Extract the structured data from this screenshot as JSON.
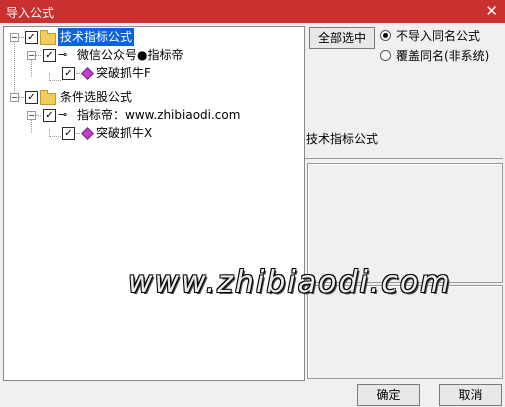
{
  "window": {
    "title": "导入公式",
    "close_glyph": "✕"
  },
  "tree": {
    "nodes": [
      {
        "label": "技术指标公式",
        "checked": true,
        "expanded": true,
        "selected": true
      },
      {
        "label": "微信公众号●指标帝",
        "checked": true
      },
      {
        "label": "突破抓牛F",
        "checked": true
      },
      {
        "label": "条件选股公式",
        "checked": true,
        "expanded": true
      },
      {
        "label": "指标帝：www.zhibiaodi.com",
        "checked": true
      },
      {
        "label": "突破抓牛X",
        "checked": true
      }
    ]
  },
  "options": {
    "select_all_label": "全部选中",
    "radio_no_import_same": "不导入同名公式",
    "radio_overwrite_same": "覆盖同名(非系统)",
    "selected": "no_import_same"
  },
  "formula_panel": {
    "title": "技术指标公式"
  },
  "watermark": "www.zhibiaodi.com",
  "footer": {
    "ok_label": "确定",
    "cancel_label": "取消"
  }
}
